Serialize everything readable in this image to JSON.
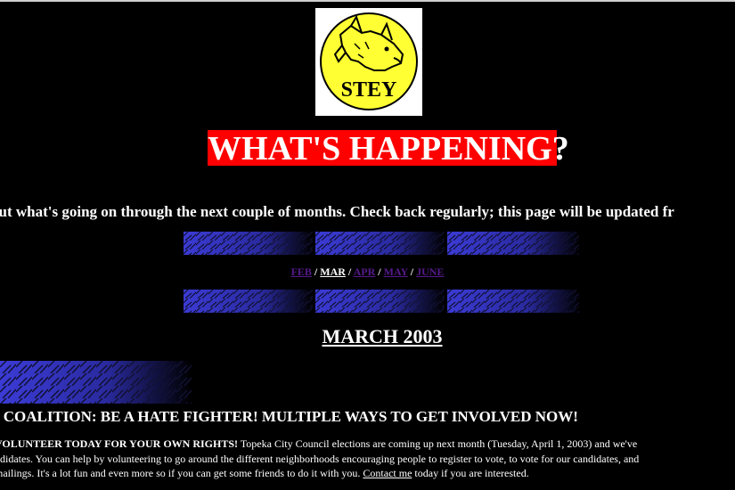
{
  "logo": {
    "text": "STEY",
    "icon": "bulldog-logo-icon",
    "bg": "#ffff33"
  },
  "title": "WHAT'S HAPPENING?",
  "intro": "out what's going on through the next couple of months. Check back regularly; this page will be updated fr",
  "month_nav": {
    "feb": "FEB",
    "mar": "MAR",
    "apr": "APR",
    "may": "MAY",
    "june": "JUNE",
    "separator": "/"
  },
  "month_heading": "MARCH 2003",
  "headline": "S COALITION: BE A HATE FIGHTER! MULTIPLE WAYS TO GET INVOLVED NOW!",
  "body": {
    "lead_bold": "VOLUNTEER TODAY FOR YOUR OWN RIGHTS!",
    "line1_rest": " Topeka City Council elections are coming up next month (Tuesday, April 1, 2003) and we've",
    "line2": "ndidates. You can help by volunteering to go around the different neighborhoods encouraging people to register to vote, to vote for our candidates, and",
    "line3_start": "mailings. It's a lot fun and even more so if you can get some friends to do it with you. ",
    "contact_link": "Contact me",
    "line3_end": " today if you are interested."
  },
  "colors": {
    "title_bg": "#ff0000",
    "tile_blue": "#3b3bd6",
    "visited_link": "#551a8b"
  }
}
